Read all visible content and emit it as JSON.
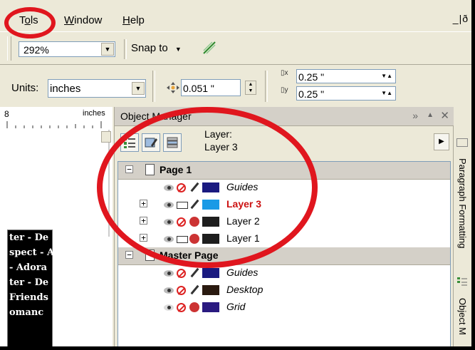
{
  "menubar": {
    "items": [
      {
        "label": "Tools",
        "underline": "o",
        "rest": "ls",
        "first": "T"
      },
      {
        "label": "Window",
        "first": "W",
        "rest": "indow"
      },
      {
        "label": "Help",
        "first": "H",
        "rest": "elp"
      }
    ],
    "window_controls": "_|ð"
  },
  "zoom_toolbar": {
    "zoom_value": "292%",
    "snap_label": "Snap to"
  },
  "property_bar": {
    "units_label": "Units:",
    "units_value": "inches",
    "nudge_value": "0.051 \"",
    "dup_x": "0.25 \"",
    "dup_y": "0.25 \""
  },
  "ruler": {
    "number": "8",
    "unit": "inches"
  },
  "canvas": {
    "text_lines": [
      "ter - De",
      "spect - A",
      "- Adora",
      "ter - De",
      "Friends",
      "omanc"
    ]
  },
  "object_manager": {
    "title": "Object Manager",
    "current_layer_label": "Layer:",
    "current_layer_name": "Layer 3",
    "pages": [
      {
        "name": "Page 1",
        "layers": [
          {
            "name": "Guides",
            "color": "#1a1a80",
            "italic": true,
            "expand": false,
            "active": false,
            "printable": false,
            "editable": true
          },
          {
            "name": "Layer 3",
            "color": "#1a9ae6",
            "italic": false,
            "expand": true,
            "active": true,
            "printable": true,
            "editable": true
          },
          {
            "name": "Layer 2",
            "color": "#1e1e1e",
            "italic": false,
            "expand": true,
            "active": false,
            "printable": false,
            "editable": false
          },
          {
            "name": "Layer 1",
            "color": "#1e1e1e",
            "italic": false,
            "expand": true,
            "active": false,
            "printable": true,
            "editable": false
          }
        ]
      },
      {
        "name": "Master Page",
        "layers": [
          {
            "name": "Guides",
            "color": "#1a1a80",
            "italic": true,
            "printable": false,
            "editable": true
          },
          {
            "name": "Desktop",
            "color": "#2a1a10",
            "italic": true,
            "printable": false,
            "editable": true
          },
          {
            "name": "Grid",
            "color": "#2a1a80",
            "italic": true,
            "printable": false,
            "editable": false
          }
        ]
      }
    ]
  },
  "vertical_tabs": [
    "Paragraph Formatting",
    "Object M"
  ],
  "colors": {
    "annotation": "#e0161e",
    "active_layer_text": "#cc1111",
    "chrome": "#ece9d8"
  }
}
